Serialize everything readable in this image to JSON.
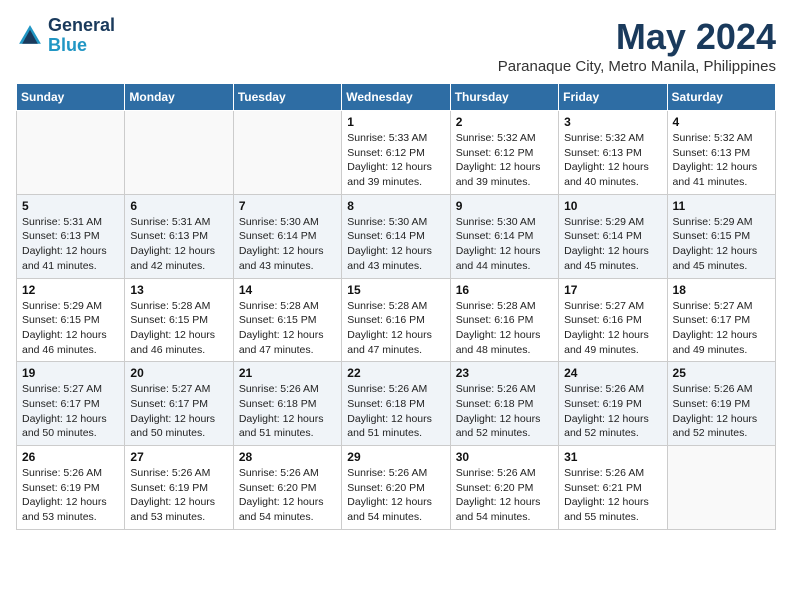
{
  "header": {
    "logo_line1": "General",
    "logo_line2": "Blue",
    "month": "May 2024",
    "location": "Paranaque City, Metro Manila, Philippines"
  },
  "days_of_week": [
    "Sunday",
    "Monday",
    "Tuesday",
    "Wednesday",
    "Thursday",
    "Friday",
    "Saturday"
  ],
  "weeks": [
    [
      {
        "day": "",
        "info": ""
      },
      {
        "day": "",
        "info": ""
      },
      {
        "day": "",
        "info": ""
      },
      {
        "day": "1",
        "info": "Sunrise: 5:33 AM\nSunset: 6:12 PM\nDaylight: 12 hours\nand 39 minutes."
      },
      {
        "day": "2",
        "info": "Sunrise: 5:32 AM\nSunset: 6:12 PM\nDaylight: 12 hours\nand 39 minutes."
      },
      {
        "day": "3",
        "info": "Sunrise: 5:32 AM\nSunset: 6:13 PM\nDaylight: 12 hours\nand 40 minutes."
      },
      {
        "day": "4",
        "info": "Sunrise: 5:32 AM\nSunset: 6:13 PM\nDaylight: 12 hours\nand 41 minutes."
      }
    ],
    [
      {
        "day": "5",
        "info": "Sunrise: 5:31 AM\nSunset: 6:13 PM\nDaylight: 12 hours\nand 41 minutes."
      },
      {
        "day": "6",
        "info": "Sunrise: 5:31 AM\nSunset: 6:13 PM\nDaylight: 12 hours\nand 42 minutes."
      },
      {
        "day": "7",
        "info": "Sunrise: 5:30 AM\nSunset: 6:14 PM\nDaylight: 12 hours\nand 43 minutes."
      },
      {
        "day": "8",
        "info": "Sunrise: 5:30 AM\nSunset: 6:14 PM\nDaylight: 12 hours\nand 43 minutes."
      },
      {
        "day": "9",
        "info": "Sunrise: 5:30 AM\nSunset: 6:14 PM\nDaylight: 12 hours\nand 44 minutes."
      },
      {
        "day": "10",
        "info": "Sunrise: 5:29 AM\nSunset: 6:14 PM\nDaylight: 12 hours\nand 45 minutes."
      },
      {
        "day": "11",
        "info": "Sunrise: 5:29 AM\nSunset: 6:15 PM\nDaylight: 12 hours\nand 45 minutes."
      }
    ],
    [
      {
        "day": "12",
        "info": "Sunrise: 5:29 AM\nSunset: 6:15 PM\nDaylight: 12 hours\nand 46 minutes."
      },
      {
        "day": "13",
        "info": "Sunrise: 5:28 AM\nSunset: 6:15 PM\nDaylight: 12 hours\nand 46 minutes."
      },
      {
        "day": "14",
        "info": "Sunrise: 5:28 AM\nSunset: 6:15 PM\nDaylight: 12 hours\nand 47 minutes."
      },
      {
        "day": "15",
        "info": "Sunrise: 5:28 AM\nSunset: 6:16 PM\nDaylight: 12 hours\nand 47 minutes."
      },
      {
        "day": "16",
        "info": "Sunrise: 5:28 AM\nSunset: 6:16 PM\nDaylight: 12 hours\nand 48 minutes."
      },
      {
        "day": "17",
        "info": "Sunrise: 5:27 AM\nSunset: 6:16 PM\nDaylight: 12 hours\nand 49 minutes."
      },
      {
        "day": "18",
        "info": "Sunrise: 5:27 AM\nSunset: 6:17 PM\nDaylight: 12 hours\nand 49 minutes."
      }
    ],
    [
      {
        "day": "19",
        "info": "Sunrise: 5:27 AM\nSunset: 6:17 PM\nDaylight: 12 hours\nand 50 minutes."
      },
      {
        "day": "20",
        "info": "Sunrise: 5:27 AM\nSunset: 6:17 PM\nDaylight: 12 hours\nand 50 minutes."
      },
      {
        "day": "21",
        "info": "Sunrise: 5:26 AM\nSunset: 6:18 PM\nDaylight: 12 hours\nand 51 minutes."
      },
      {
        "day": "22",
        "info": "Sunrise: 5:26 AM\nSunset: 6:18 PM\nDaylight: 12 hours\nand 51 minutes."
      },
      {
        "day": "23",
        "info": "Sunrise: 5:26 AM\nSunset: 6:18 PM\nDaylight: 12 hours\nand 52 minutes."
      },
      {
        "day": "24",
        "info": "Sunrise: 5:26 AM\nSunset: 6:19 PM\nDaylight: 12 hours\nand 52 minutes."
      },
      {
        "day": "25",
        "info": "Sunrise: 5:26 AM\nSunset: 6:19 PM\nDaylight: 12 hours\nand 52 minutes."
      }
    ],
    [
      {
        "day": "26",
        "info": "Sunrise: 5:26 AM\nSunset: 6:19 PM\nDaylight: 12 hours\nand 53 minutes."
      },
      {
        "day": "27",
        "info": "Sunrise: 5:26 AM\nSunset: 6:19 PM\nDaylight: 12 hours\nand 53 minutes."
      },
      {
        "day": "28",
        "info": "Sunrise: 5:26 AM\nSunset: 6:20 PM\nDaylight: 12 hours\nand 54 minutes."
      },
      {
        "day": "29",
        "info": "Sunrise: 5:26 AM\nSunset: 6:20 PM\nDaylight: 12 hours\nand 54 minutes."
      },
      {
        "day": "30",
        "info": "Sunrise: 5:26 AM\nSunset: 6:20 PM\nDaylight: 12 hours\nand 54 minutes."
      },
      {
        "day": "31",
        "info": "Sunrise: 5:26 AM\nSunset: 6:21 PM\nDaylight: 12 hours\nand 55 minutes."
      },
      {
        "day": "",
        "info": ""
      }
    ]
  ]
}
